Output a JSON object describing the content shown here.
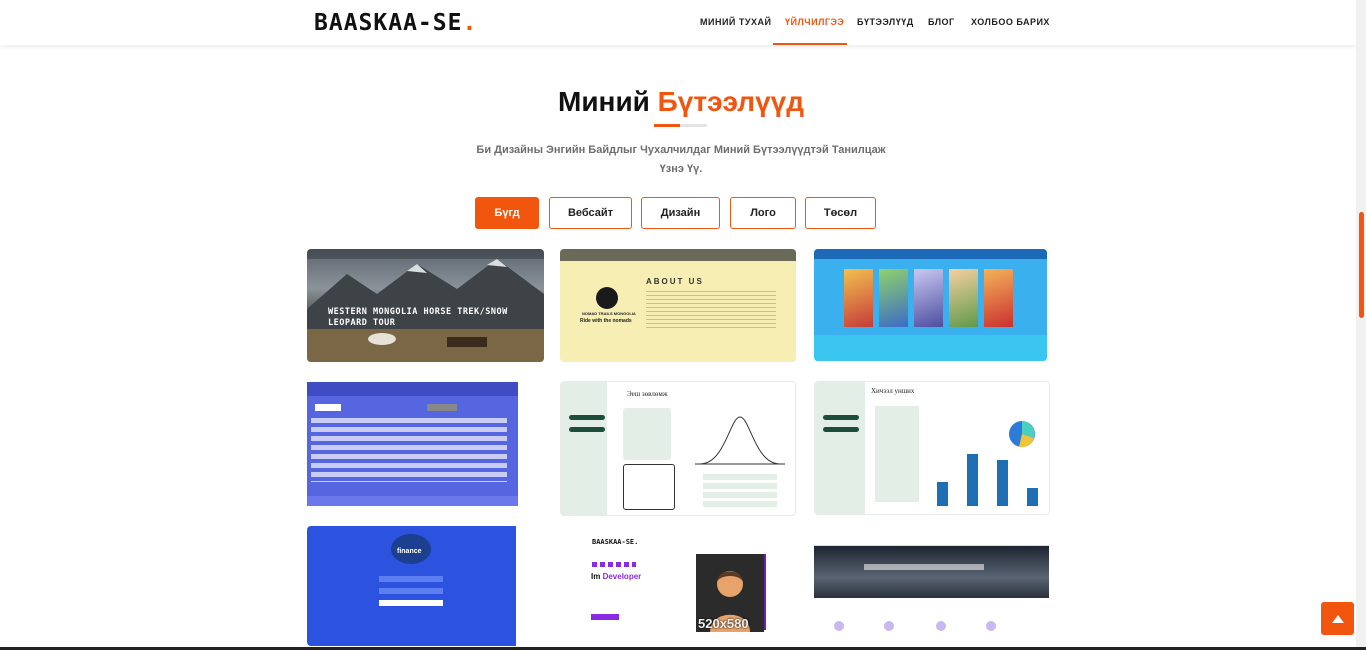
{
  "header": {
    "logo_text": "BAASKAA-SE",
    "logo_dot": ".",
    "nav": [
      {
        "label": "МИНИЙ ТУХАЙ"
      },
      {
        "label": "ҮЙЛЧИЛГЭЭ"
      },
      {
        "label": "БҮТЭЭЛҮҮД"
      },
      {
        "label": "БЛОГ"
      },
      {
        "label": "ХОЛБОО БАРИХ"
      }
    ],
    "active_nav": "ҮЙЛЧИЛГЭЭ"
  },
  "section": {
    "title_part1": "Миний",
    "title_part2": "Бүтээлүүд",
    "subtitle": "Би Дизайны Энгийн Байдлыг Чухалчилдаг Миний Бүтээлүүдтэй Танилцаж Үзнэ Үү."
  },
  "filters": [
    {
      "label": "Бүгд"
    },
    {
      "label": "Вебсайт"
    },
    {
      "label": "Дизайн"
    },
    {
      "label": "Лого"
    },
    {
      "label": "Төсөл"
    }
  ],
  "active_filter": "Бүгд",
  "portfolio": {
    "item1": {
      "headline": "WESTERN MONGOLIA HORSE TREK/SNOW LEOPARD TOUR"
    },
    "item2": {
      "heading": "ABOUT US",
      "brand": "NOMAD TRAILS MONGOLIA",
      "tagline": "Ride with the nomads"
    },
    "item5": {
      "heading": "Эеш зөвлөмж"
    },
    "item6": {
      "heading": "Хичээл унших"
    },
    "item7": {
      "brand": "finance"
    },
    "item8": {
      "logo": "BAASKAA-SE.",
      "headline_part1": "Im",
      "headline_part2": "Developer",
      "placeholder": "520x580"
    }
  },
  "colors": {
    "accent": "#f1550e",
    "dark": "#222222"
  }
}
